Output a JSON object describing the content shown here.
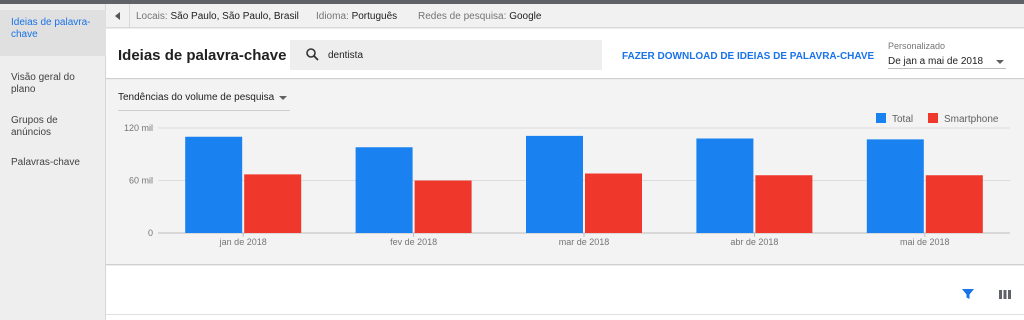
{
  "sidebar": {
    "items": [
      {
        "label": "Ideias de palavra-chave",
        "active": true
      },
      {
        "label": "Visão geral do plano",
        "active": false
      },
      {
        "label": "Grupos de anúncios",
        "active": false
      },
      {
        "label": "Palavras-chave",
        "active": false
      }
    ]
  },
  "filterbar": {
    "locations_label": "Locais:",
    "locations_value": "São Paulo, São Paulo, Brasil",
    "language_label": "Idioma:",
    "language_value": "Português",
    "networks_label": "Redes de pesquisa:",
    "networks_value": "Google",
    "collapse_icon": "triangle-left-icon"
  },
  "header": {
    "title": "Ideias de palavra-chave",
    "search_value": "dentista",
    "search_icon": "search-icon",
    "download_label": "FAZER DOWNLOAD DE IDEIAS DE PALAVRA-CHAVE",
    "range_caption": "Personalizado",
    "range_value": "De jan a mai de 2018"
  },
  "chart_panel": {
    "metric_select": "Tendências do volume de pesquisa"
  },
  "colors": {
    "accent": "#1a73e8",
    "total": "#1a82f0",
    "smartphone": "#f0372c"
  },
  "chart_data": {
    "type": "bar",
    "categories": [
      "jan de 2018",
      "fev de 2018",
      "mar de 2018",
      "abr de 2018",
      "mai de 2018"
    ],
    "series": [
      {
        "name": "Total",
        "values": [
          110000,
          98000,
          111000,
          108000,
          107000
        ]
      },
      {
        "name": "Smartphone",
        "values": [
          67000,
          60000,
          68000,
          66000,
          66000
        ]
      }
    ],
    "yticks": [
      0,
      60000,
      120000
    ],
    "ytick_labels": [
      "0",
      "60 mil",
      "120 mil"
    ],
    "ylim": [
      0,
      120000
    ],
    "grid": true,
    "legend_position": "top-right",
    "xlabel": "",
    "ylabel": ""
  },
  "bottom_toolbar": {
    "filter_icon": "filter-icon",
    "columns_icon": "columns-icon"
  }
}
